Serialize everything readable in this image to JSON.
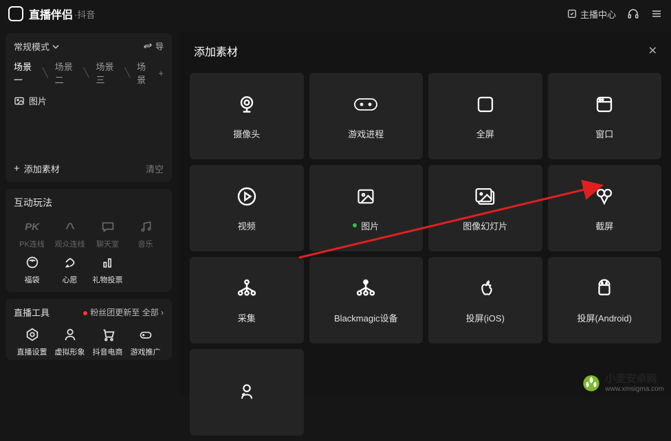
{
  "app": {
    "title": "直播伴侣",
    "sub": "·抖音"
  },
  "topbar": {
    "center": "主播中心"
  },
  "mode": {
    "label": "常规模式",
    "swap": "导"
  },
  "scenes": [
    "场景一",
    "场景二",
    "场景三",
    "场景"
  ],
  "layer": {
    "pic": "图片"
  },
  "assets": {
    "add": "添加素材",
    "clear": "清空"
  },
  "play": {
    "title": "互动玩法",
    "items": [
      "PK连线",
      "观众连线",
      "聊天室",
      "音乐",
      "福袋",
      "心愿",
      "礼物投票"
    ]
  },
  "tools": {
    "title": "直播工具",
    "note": "粉丝团更新至",
    "all": "全部",
    "items": [
      "直播设置",
      "虚拟形象",
      "抖音电商",
      "游戏推广"
    ]
  },
  "modal": {
    "title": "添加素材",
    "items": [
      {
        "id": "camera",
        "label": "摄像头"
      },
      {
        "id": "game",
        "label": "游戏进程"
      },
      {
        "id": "fullscreen",
        "label": "全屏"
      },
      {
        "id": "window",
        "label": "窗口"
      },
      {
        "id": "video",
        "label": "视频"
      },
      {
        "id": "image",
        "label": "图片",
        "dot": true
      },
      {
        "id": "slideshow",
        "label": "图像幻灯片"
      },
      {
        "id": "screenshot",
        "label": "截屏"
      },
      {
        "id": "capture",
        "label": "采集"
      },
      {
        "id": "blackmagic",
        "label": "Blackmagic设备"
      },
      {
        "id": "ios",
        "label": "投屏(iOS)"
      },
      {
        "id": "android",
        "label": "投屏(Android)"
      }
    ]
  },
  "watermark": {
    "cn": "小麦安卓网",
    "url": "www.xmsigma.com"
  }
}
